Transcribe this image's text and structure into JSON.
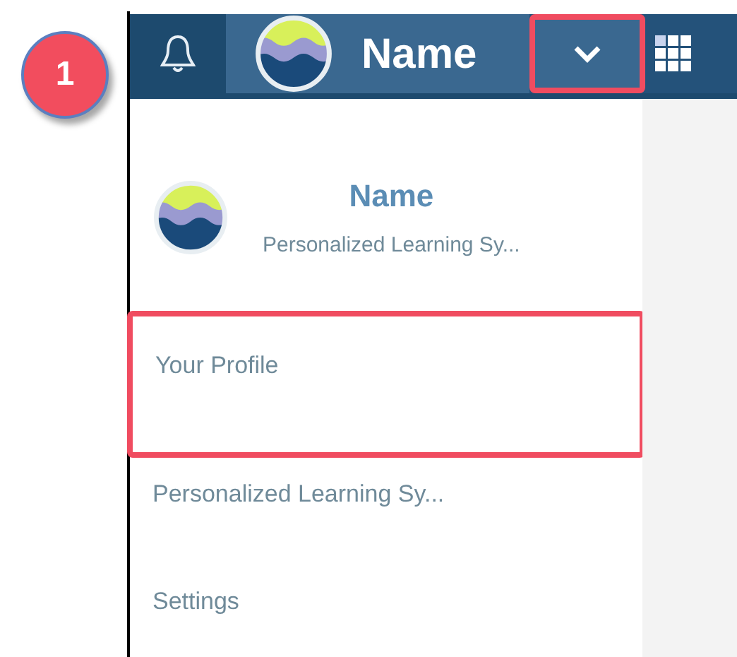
{
  "step_badge": "1",
  "top_bar": {
    "user_name": "Name",
    "dropdown_toggle": {
      "highlighted": true
    }
  },
  "dropdown": {
    "header": {
      "name": "Name",
      "subtitle": "Personalized Learning Sy..."
    },
    "items": [
      {
        "label": "Your Profile",
        "highlighted": true
      },
      {
        "label": "Personalized Learning Sy...",
        "highlighted": false
      },
      {
        "label": "Settings",
        "highlighted": false
      }
    ]
  }
}
